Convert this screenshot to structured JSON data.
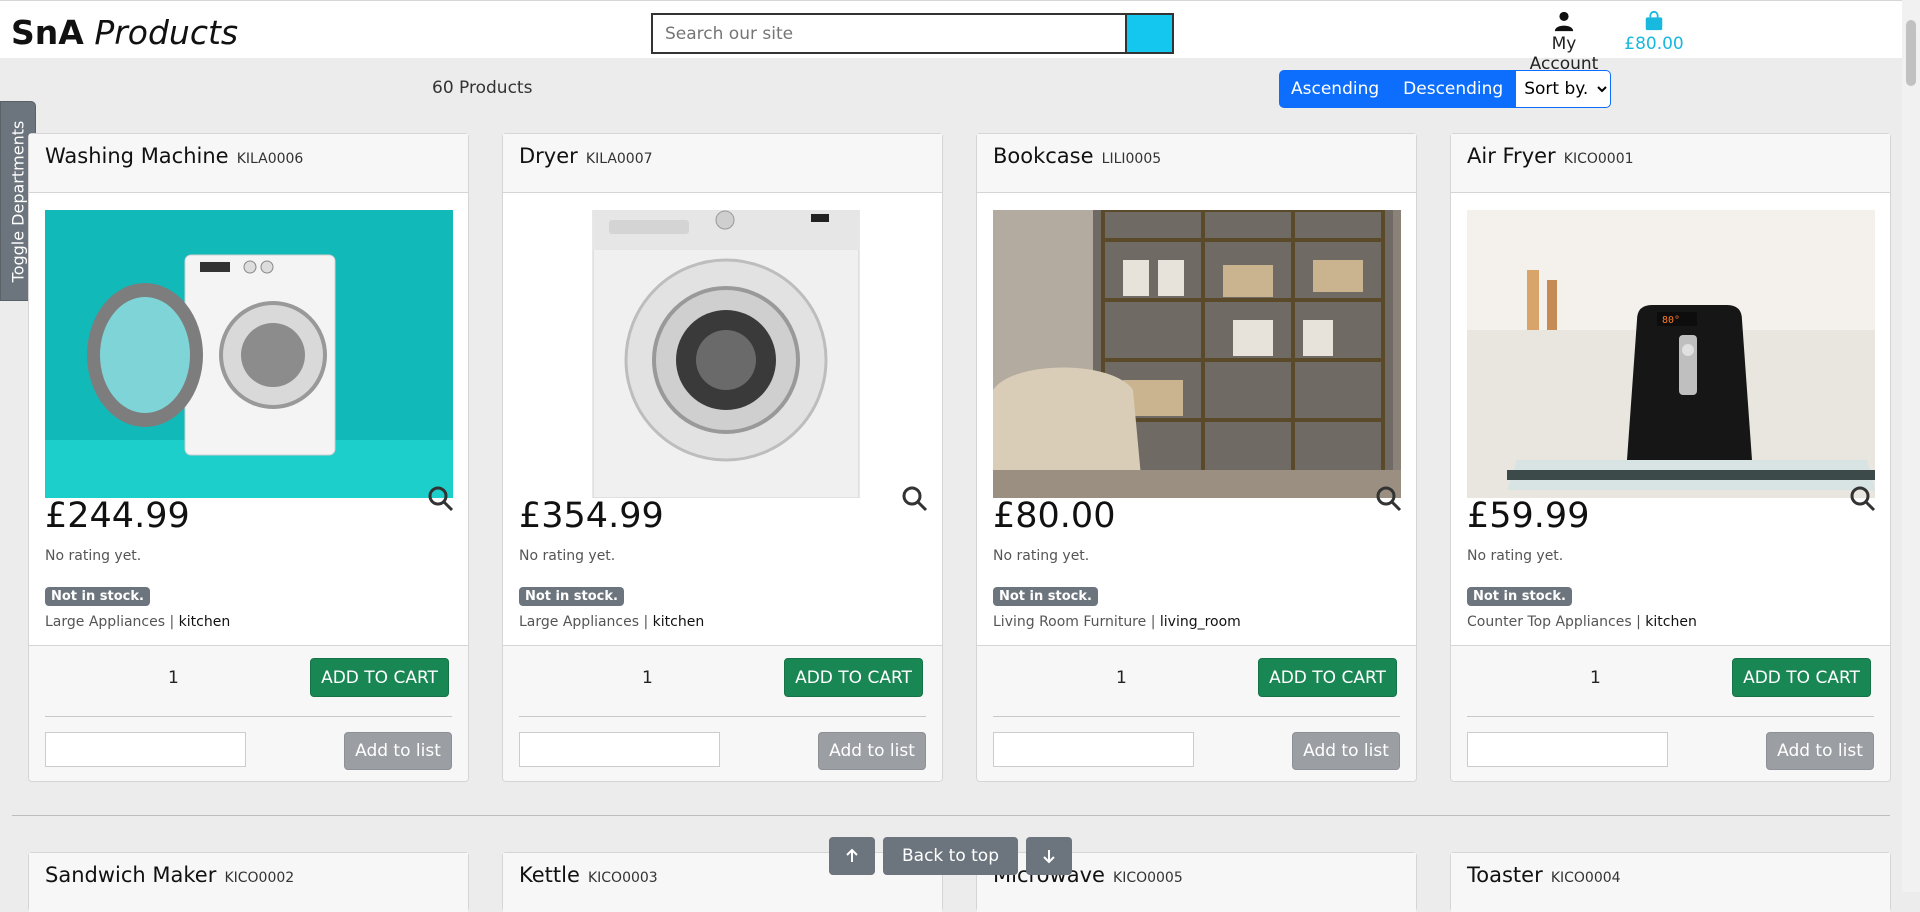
{
  "header": {
    "logo_bold": "SnA",
    "logo_italic": "Products",
    "search_placeholder": "Search our site",
    "account_label": "My Account",
    "cart_total": "£80.00"
  },
  "sidebar": {
    "toggle_label": "Toggle Departments"
  },
  "toolbar": {
    "product_count": "60 Products",
    "ascending_label": "Ascending",
    "descending_label": "Descending",
    "sort_selected": "Sort by..."
  },
  "products": [
    {
      "name": "Washing Machine",
      "code": "KILA0006",
      "price": "£244.99",
      "rating": "No rating yet.",
      "stock": "Not in stock.",
      "department": "Large Appliances",
      "room": "kitchen",
      "qty": "1",
      "add_cart": "ADD TO CART",
      "add_list": "Add to list"
    },
    {
      "name": "Dryer",
      "code": "KILA0007",
      "price": "£354.99",
      "rating": "No rating yet.",
      "stock": "Not in stock.",
      "department": "Large Appliances",
      "room": "kitchen",
      "qty": "1",
      "add_cart": "ADD TO CART",
      "add_list": "Add to list"
    },
    {
      "name": "Bookcase",
      "code": "LILI0005",
      "price": "£80.00",
      "rating": "No rating yet.",
      "stock": "Not in stock.",
      "department": "Living Room Furniture",
      "room": "living_room",
      "qty": "1",
      "add_cart": "ADD TO CART",
      "add_list": "Add to list"
    },
    {
      "name": "Air Fryer",
      "code": "KICO0001",
      "price": "£59.99",
      "rating": "No rating yet.",
      "stock": "Not in stock.",
      "department": "Counter Top Appliances",
      "room": "kitchen",
      "qty": "1",
      "add_cart": "ADD TO CART",
      "add_list": "Add to list"
    }
  ],
  "next_row": [
    {
      "name": "Sandwich Maker",
      "code": "KICO0002"
    },
    {
      "name": "Kettle",
      "code": "KICO0003"
    },
    {
      "name": "Microwave",
      "code": "KICO0005"
    },
    {
      "name": "Toaster",
      "code": "KICO0004"
    }
  ],
  "footer_nav": {
    "back_to_top": "Back to top"
  },
  "colors": {
    "accent": "#13c7ef",
    "primary": "#0d6efd",
    "success": "#198754",
    "secondary": "#6c757d"
  }
}
